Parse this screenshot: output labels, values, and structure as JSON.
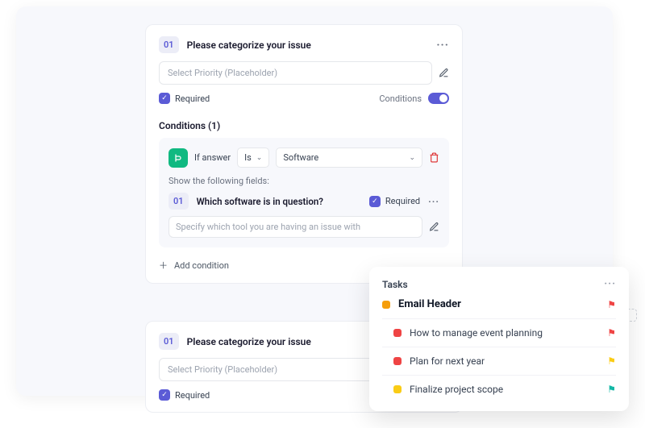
{
  "form": {
    "q1": {
      "num": "01",
      "title": "Please categorize your issue",
      "placeholder": "Select Priority (Placeholder)",
      "required_label": "Required",
      "conditions_label": "Conditions",
      "conditions_count_label": "Conditions (1)"
    },
    "condition": {
      "if_label": "If answer",
      "operator": "Is",
      "value": "Software",
      "show_label": "Show the following fields:",
      "subq_num": "01",
      "subq_title": "Which software is in question?",
      "subq_required": "Required",
      "subq_placeholder": "Specify which tool you are having an issue with",
      "add_label": "Add condition"
    },
    "q2": {
      "num": "01",
      "title": "Please categorize your issue",
      "placeholder": "Select Priority (Placeholder)",
      "required_label": "Required"
    }
  },
  "tasks": {
    "title": "Tasks",
    "items": [
      {
        "label": "Email Header",
        "color": "orange",
        "flag": "red",
        "bold": true
      },
      {
        "label": "How to manage event planning",
        "color": "red",
        "flag": "red",
        "indent": true
      },
      {
        "label": "Plan for next year",
        "color": "red",
        "flag": "yellow",
        "indent": true
      },
      {
        "label": "Finalize project scope",
        "color": "yellow",
        "flag": "teal",
        "indent": true
      }
    ]
  }
}
